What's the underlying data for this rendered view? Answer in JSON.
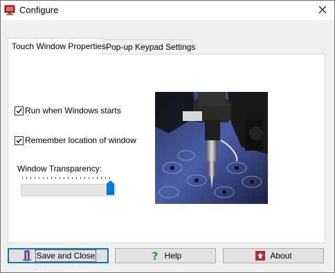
{
  "window": {
    "title": "Configure",
    "icon": "monitor-icon",
    "close_icon": "close-icon"
  },
  "tabs": [
    {
      "label": "Touch Window Properties",
      "active": true
    },
    {
      "label": "Pop-up Keypad Settings",
      "active": false
    }
  ],
  "touch_window": {
    "run_on_startup": {
      "label": "Run when Windows starts",
      "checked": true
    },
    "remember_location": {
      "label": "Remember location of window",
      "checked": true
    },
    "transparency": {
      "label": "Window Transparency:",
      "value_fraction": 1.0
    },
    "image": "industrial-dispenser-photo"
  },
  "buttons": {
    "save_close": {
      "label": "Save and Close",
      "icon": "save-close-icon"
    },
    "help": {
      "label": "Help",
      "icon": "question-icon"
    },
    "about": {
      "label": "About",
      "icon": "about-icon"
    }
  },
  "colors": {
    "accent": "#0078d7",
    "panel": "#ffffff",
    "face": "#f0f0f0",
    "help_icon": "#1e9c3c",
    "about_icon": "#b52a2a"
  }
}
